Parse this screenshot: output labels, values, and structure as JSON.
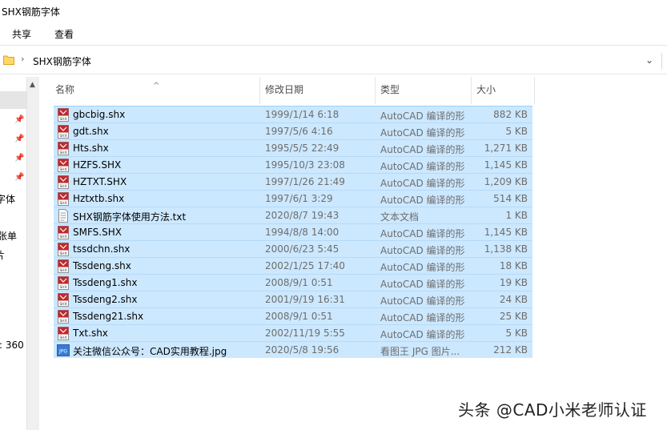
{
  "window": {
    "title": "SHX钢筋字体"
  },
  "ribbon": {
    "tabs": [
      "共享",
      "查看"
    ]
  },
  "address": {
    "separator": "›",
    "path": "SHX钢筋字体",
    "dropdown": "⌄"
  },
  "nav": {
    "pins": [
      "📌",
      "📌",
      "📌",
      "📌"
    ],
    "labels": [
      "字体",
      "张单",
      "片",
      ": 360"
    ]
  },
  "columns": {
    "name": "名称",
    "date": "修改日期",
    "type": "类型",
    "size": "大小"
  },
  "files": [
    {
      "name": "gbcbig.shx",
      "date": "1999/1/14 6:18",
      "type": "AutoCAD 编译的形",
      "size": "882 KB",
      "icon": "shx-file-icon"
    },
    {
      "name": "gdt.shx",
      "date": "1997/5/6 4:16",
      "type": "AutoCAD 编译的形",
      "size": "5 KB",
      "icon": "shx-file-icon"
    },
    {
      "name": "Hts.shx",
      "date": "1995/5/5 22:49",
      "type": "AutoCAD 编译的形",
      "size": "1,271 KB",
      "icon": "shx-file-icon"
    },
    {
      "name": "HZFS.SHX",
      "date": "1995/10/3 23:08",
      "type": "AutoCAD 编译的形",
      "size": "1,145 KB",
      "icon": "shx-file-icon"
    },
    {
      "name": "HZTXT.SHX",
      "date": "1997/1/26 21:49",
      "type": "AutoCAD 编译的形",
      "size": "1,209 KB",
      "icon": "shx-file-icon"
    },
    {
      "name": "Hztxtb.shx",
      "date": "1997/6/1 3:29",
      "type": "AutoCAD 编译的形",
      "size": "514 KB",
      "icon": "shx-file-icon"
    },
    {
      "name": "SHX钢筋字体使用方法.txt",
      "date": "2020/8/7 19:43",
      "type": "文本文档",
      "size": "1 KB",
      "icon": "txt-file-icon"
    },
    {
      "name": "SMFS.SHX",
      "date": "1994/8/8 14:00",
      "type": "AutoCAD 编译的形",
      "size": "1,145 KB",
      "icon": "shx-file-icon"
    },
    {
      "name": "tssdchn.shx",
      "date": "2000/6/23 5:45",
      "type": "AutoCAD 编译的形",
      "size": "1,138 KB",
      "icon": "shx-file-icon"
    },
    {
      "name": "Tssdeng.shx",
      "date": "2002/1/25 17:40",
      "type": "AutoCAD 编译的形",
      "size": "18 KB",
      "icon": "shx-file-icon"
    },
    {
      "name": "Tssdeng1.shx",
      "date": "2008/9/1 0:51",
      "type": "AutoCAD 编译的形",
      "size": "19 KB",
      "icon": "shx-file-icon"
    },
    {
      "name": "Tssdeng2.shx",
      "date": "2001/9/19 16:31",
      "type": "AutoCAD 编译的形",
      "size": "24 KB",
      "icon": "shx-file-icon"
    },
    {
      "name": "Tssdeng21.shx",
      "date": "2008/9/1 0:51",
      "type": "AutoCAD 编译的形",
      "size": "25 KB",
      "icon": "shx-file-icon"
    },
    {
      "name": "Txt.shx",
      "date": "2002/11/19 5:55",
      "type": "AutoCAD 编译的形",
      "size": "5 KB",
      "icon": "shx-file-icon"
    },
    {
      "name": "关注微信公众号：CAD实用教程.jpg",
      "date": "2020/5/8 19:56",
      "type": "看图王 JPG 图片...",
      "size": "212 KB",
      "icon": "jpg-file-icon"
    }
  ],
  "watermark": "头条 @CAD小米老师认证",
  "colors": {
    "selection": "#cce8ff",
    "selection_border": "#99d1ff",
    "shx_icon": "#c0282d",
    "jpg_icon": "#3a7bd5"
  }
}
